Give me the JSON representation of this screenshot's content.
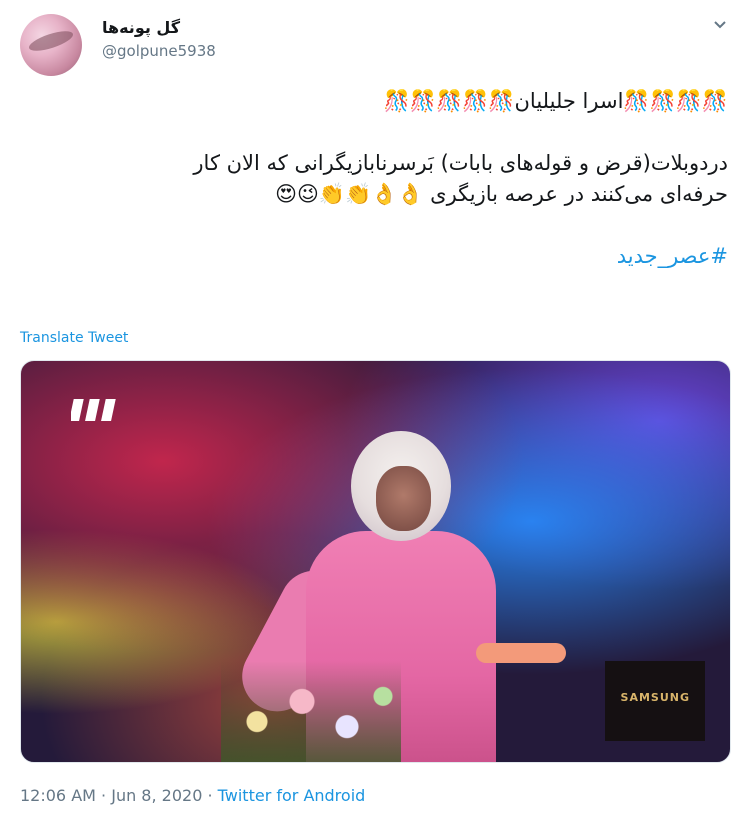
{
  "author": {
    "display_name": "گل پونه‌ها",
    "handle": "@golpune5938",
    "avatar_icon": "avatar-flower-photo"
  },
  "tweet": {
    "line1": "🎊🎊🎊🎊اسرا جلیلیان🎊🎊🎊🎊🎊",
    "line2": "دردوبلات(قرض و قوله‌های بابات) بَرسرنابازیگرانی که الان کار",
    "line3": "حرفه‌ای می‌کنند در عرصه بازیگری 👌👌👏👏😉😍",
    "hashtag": "#عصر_جدید",
    "translate_label": "Translate Tweet"
  },
  "media": {
    "logo_text": "III",
    "corner_text": "SAMSUNG"
  },
  "footer": {
    "time": "12:06 AM",
    "separator1": " · ",
    "date": "Jun 8, 2020",
    "separator2": " · ",
    "source": "Twitter for Android"
  },
  "colors": {
    "link_blue": "#1b95e0",
    "meta_gray": "#657786"
  }
}
